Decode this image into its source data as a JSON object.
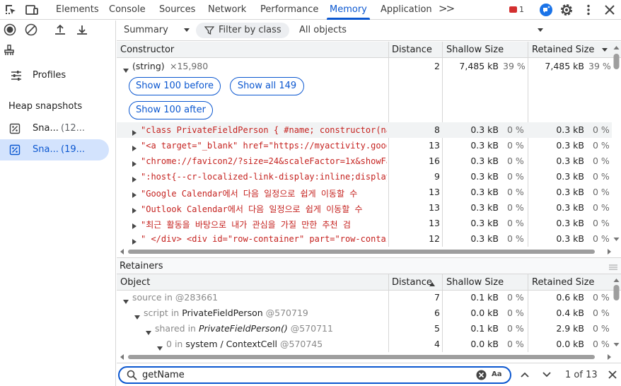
{
  "tabs": [
    "Elements",
    "Console",
    "Sources",
    "Network",
    "Performance",
    "Memory",
    "Application"
  ],
  "active_tab": "Memory",
  "error_count": "1",
  "sidebar": {
    "profiles_label": "Profiles",
    "heap_heading": "Heap snapshots",
    "snapshots": [
      {
        "name": "Sna...",
        "size": "(12..."
      },
      {
        "name": "Sna...",
        "size": "(19..."
      }
    ]
  },
  "toolbar": {
    "view": "Summary",
    "filter_placeholder": "Filter by class",
    "scope": "All objects"
  },
  "constructor_grid": {
    "headers": {
      "constructor": "Constructor",
      "distance": "Distance",
      "shallow": "Shallow Size",
      "retained": "Retained Size"
    },
    "group": {
      "name": "(string)",
      "count": "×15,980",
      "distance": "2",
      "shallow": "7,485 kB",
      "shallow_pct": "39 %",
      "retained": "7,485 kB",
      "retained_pct": "39 %"
    },
    "buttons": {
      "before": "Show 100 before",
      "all": "Show all 149",
      "after": "Show 100 after"
    },
    "rows": [
      {
        "text": "\"class PrivateFieldPerson { #name; constructor(nam",
        "distance": "8",
        "shallow": "0.3 kB",
        "shallow_pct": "0 %",
        "retained": "0.3 kB",
        "retained_pct": "0 %"
      },
      {
        "text": "\"<a target=\"_blank\" href=\"https://myactivity.googl",
        "distance": "13",
        "shallow": "0.3 kB",
        "shallow_pct": "0 %",
        "retained": "0.3 kB",
        "retained_pct": "0 %"
      },
      {
        "text": "\"chrome://favicon2/?size=24&scaleFactor=1x&showFal",
        "distance": "16",
        "shallow": "0.3 kB",
        "shallow_pct": "0 %",
        "retained": "0.3 kB",
        "retained_pct": "0 %"
      },
      {
        "text": "\":host{--cr-localized-link-display:inline;display:",
        "distance": "9",
        "shallow": "0.3 kB",
        "shallow_pct": "0 %",
        "retained": "0.3 kB",
        "retained_pct": "0 %"
      },
      {
        "text": "\"Google Calendar에서 다음 일정으로 쉽게 이동할 수",
        "distance": "13",
        "shallow": "0.3 kB",
        "shallow_pct": "0 %",
        "retained": "0.3 kB",
        "retained_pct": "0 %"
      },
      {
        "text": "\"Outlook Calendar에서 다음 일정으로 쉽게 이동할 수",
        "distance": "13",
        "shallow": "0.3 kB",
        "shallow_pct": "0 %",
        "retained": "0.3 kB",
        "retained_pct": "0 %"
      },
      {
        "text": "\"최근 활동을 바탕으로 내가 관심을 가질 만한 추천 검",
        "distance": "13",
        "shallow": "0.3 kB",
        "shallow_pct": "0 %",
        "retained": "0.3 kB",
        "retained_pct": "0 %"
      },
      {
        "text": "\" </div> <div id=\"row-container\" part=\"row-contain",
        "distance": "12",
        "shallow": "0.3 kB",
        "shallow_pct": "0 %",
        "retained": "0.3 kB",
        "retained_pct": "0 %"
      }
    ]
  },
  "retainers": {
    "title": "Retainers",
    "headers": {
      "object": "Object",
      "distance": "Distance",
      "shallow": "Shallow Size",
      "retained": "Retained Size"
    },
    "rows": [
      {
        "prop": "source",
        "in": "in",
        "obj": "",
        "id": "@283661",
        "distance": "7",
        "shallow": "0.1 kB",
        "shallow_pct": "0 %",
        "retained": "0.6 kB",
        "retained_pct": "0 %"
      },
      {
        "prop": "script",
        "in": "in",
        "obj": "PrivateFieldPerson",
        "id": "@570719",
        "distance": "6",
        "shallow": "0.0 kB",
        "shallow_pct": "0 %",
        "retained": "0.4 kB",
        "retained_pct": "0 %"
      },
      {
        "prop": "shared",
        "in": "in",
        "obj": "PrivateFieldPerson()",
        "id": "@570711",
        "distance": "5",
        "shallow": "0.1 kB",
        "shallow_pct": "0 %",
        "retained": "2.9 kB",
        "retained_pct": "0 %"
      },
      {
        "prop": "0",
        "in": "in",
        "obj": "system / ContextCell",
        "id": "@570745",
        "distance": "4",
        "shallow": "0.0 kB",
        "shallow_pct": "0 %",
        "retained": "0.0 kB",
        "retained_pct": "0 %"
      }
    ]
  },
  "search": {
    "query": "getName",
    "match_case": "Aa",
    "match_count": "1 of 13"
  }
}
